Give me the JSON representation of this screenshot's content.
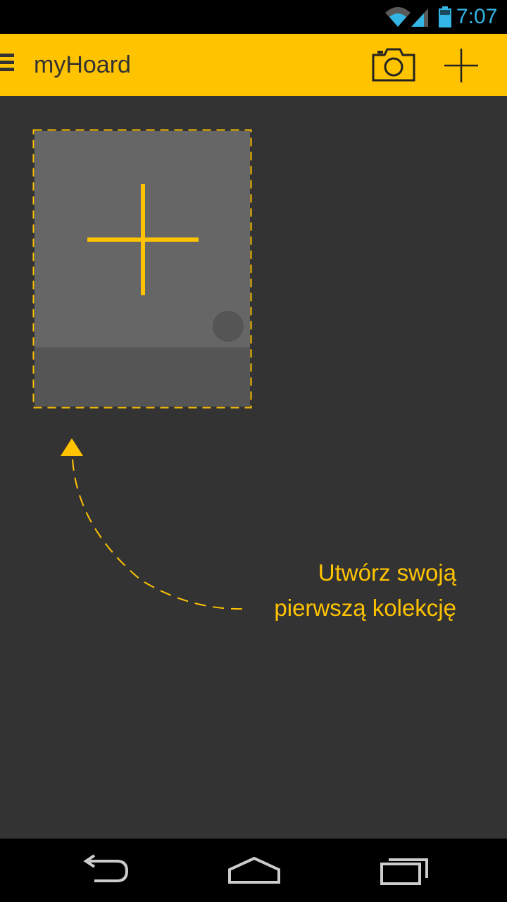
{
  "status_bar": {
    "time": "7:07",
    "icons": [
      "wifi-icon",
      "signal-icon",
      "battery-icon"
    ],
    "accent_color": "#33b5e5"
  },
  "action_bar": {
    "title": "myHoard",
    "background_color": "#ffc300",
    "icons": [
      "menu-icon",
      "camera-icon",
      "add-icon"
    ]
  },
  "main": {
    "add_collection_card_icon": "plus-icon",
    "hint_line_1": "Utwórz swoją",
    "hint_line_2": "pierwszą kolekcję",
    "accent_color": "#ffc300"
  },
  "nav_bar": {
    "icons": [
      "back-icon",
      "home-icon",
      "recent-apps-icon"
    ]
  }
}
